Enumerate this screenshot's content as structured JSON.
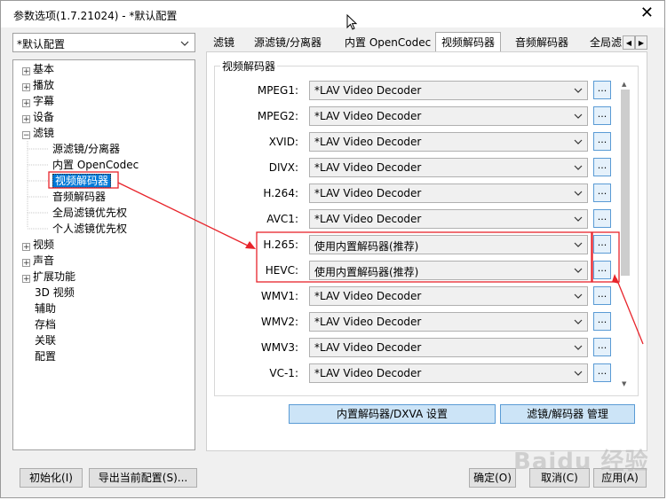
{
  "window": {
    "title": "参数选项(1.7.21024) - *默认配置",
    "close_glyph": "✕"
  },
  "profile": {
    "value": "*默认配置"
  },
  "tree": {
    "items": [
      {
        "label": "基本",
        "exp": "+"
      },
      {
        "label": "播放",
        "exp": "+"
      },
      {
        "label": "字幕",
        "exp": "+"
      },
      {
        "label": "设备",
        "exp": "+"
      },
      {
        "label": "滤镜",
        "exp": "−"
      },
      {
        "label": "源滤镜/分离器"
      },
      {
        "label": "内置 OpenCodec"
      },
      {
        "label": "视频解码器",
        "selected": true
      },
      {
        "label": "音频解码器"
      },
      {
        "label": "全局滤镜优先权"
      },
      {
        "label": "个人滤镜优先权"
      },
      {
        "label": "视频",
        "exp": "+"
      },
      {
        "label": "声音",
        "exp": "+"
      },
      {
        "label": "扩展功能",
        "exp": "+"
      },
      {
        "label": "3D 视频"
      },
      {
        "label": "辅助"
      },
      {
        "label": "存档"
      },
      {
        "label": "关联"
      },
      {
        "label": "配置"
      }
    ]
  },
  "tabs": [
    {
      "label": "滤镜"
    },
    {
      "label": "源滤镜/分离器"
    },
    {
      "label": "内置 OpenCodec"
    },
    {
      "label": "视频解码器",
      "active": true
    },
    {
      "label": "音频解码器"
    },
    {
      "label": "全局滤"
    }
  ],
  "tab_scroll": {
    "left": "◀",
    "right": "▶"
  },
  "group": {
    "title": "视频解码器"
  },
  "decoders": [
    {
      "label": "MPEG1:",
      "value": "*LAV Video Decoder"
    },
    {
      "label": "MPEG2:",
      "value": "*LAV Video Decoder"
    },
    {
      "label": "XVID:",
      "value": "*LAV Video Decoder"
    },
    {
      "label": "DIVX:",
      "value": "*LAV Video Decoder"
    },
    {
      "label": "H.264:",
      "value": "*LAV Video Decoder"
    },
    {
      "label": "AVC1:",
      "value": "*LAV Video Decoder"
    },
    {
      "label": "H.265:",
      "value": "使用内置解码器(推荐)"
    },
    {
      "label": "HEVC:",
      "value": "使用内置解码器(推荐)"
    },
    {
      "label": "WMV1:",
      "value": "*LAV Video Decoder"
    },
    {
      "label": "WMV2:",
      "value": "*LAV Video Decoder"
    },
    {
      "label": "WMV3:",
      "value": "*LAV Video Decoder"
    },
    {
      "label": "VC-1:",
      "value": "*LAV Video Decoder"
    }
  ],
  "dots_label": "...",
  "actions": {
    "internal_dxva": "内置解码器/DXVA 设置",
    "filter_manage": "滤镜/解码器 管理"
  },
  "footer": {
    "init": "初始化(I)",
    "export": "导出当前配置(S)...",
    "ok": "确定(O)",
    "cancel": "取消(C)",
    "apply": "应用(A)"
  },
  "watermark": "Baidu 经验",
  "colors": {
    "selection": "#0078d7",
    "annotation": "#e8242b"
  }
}
